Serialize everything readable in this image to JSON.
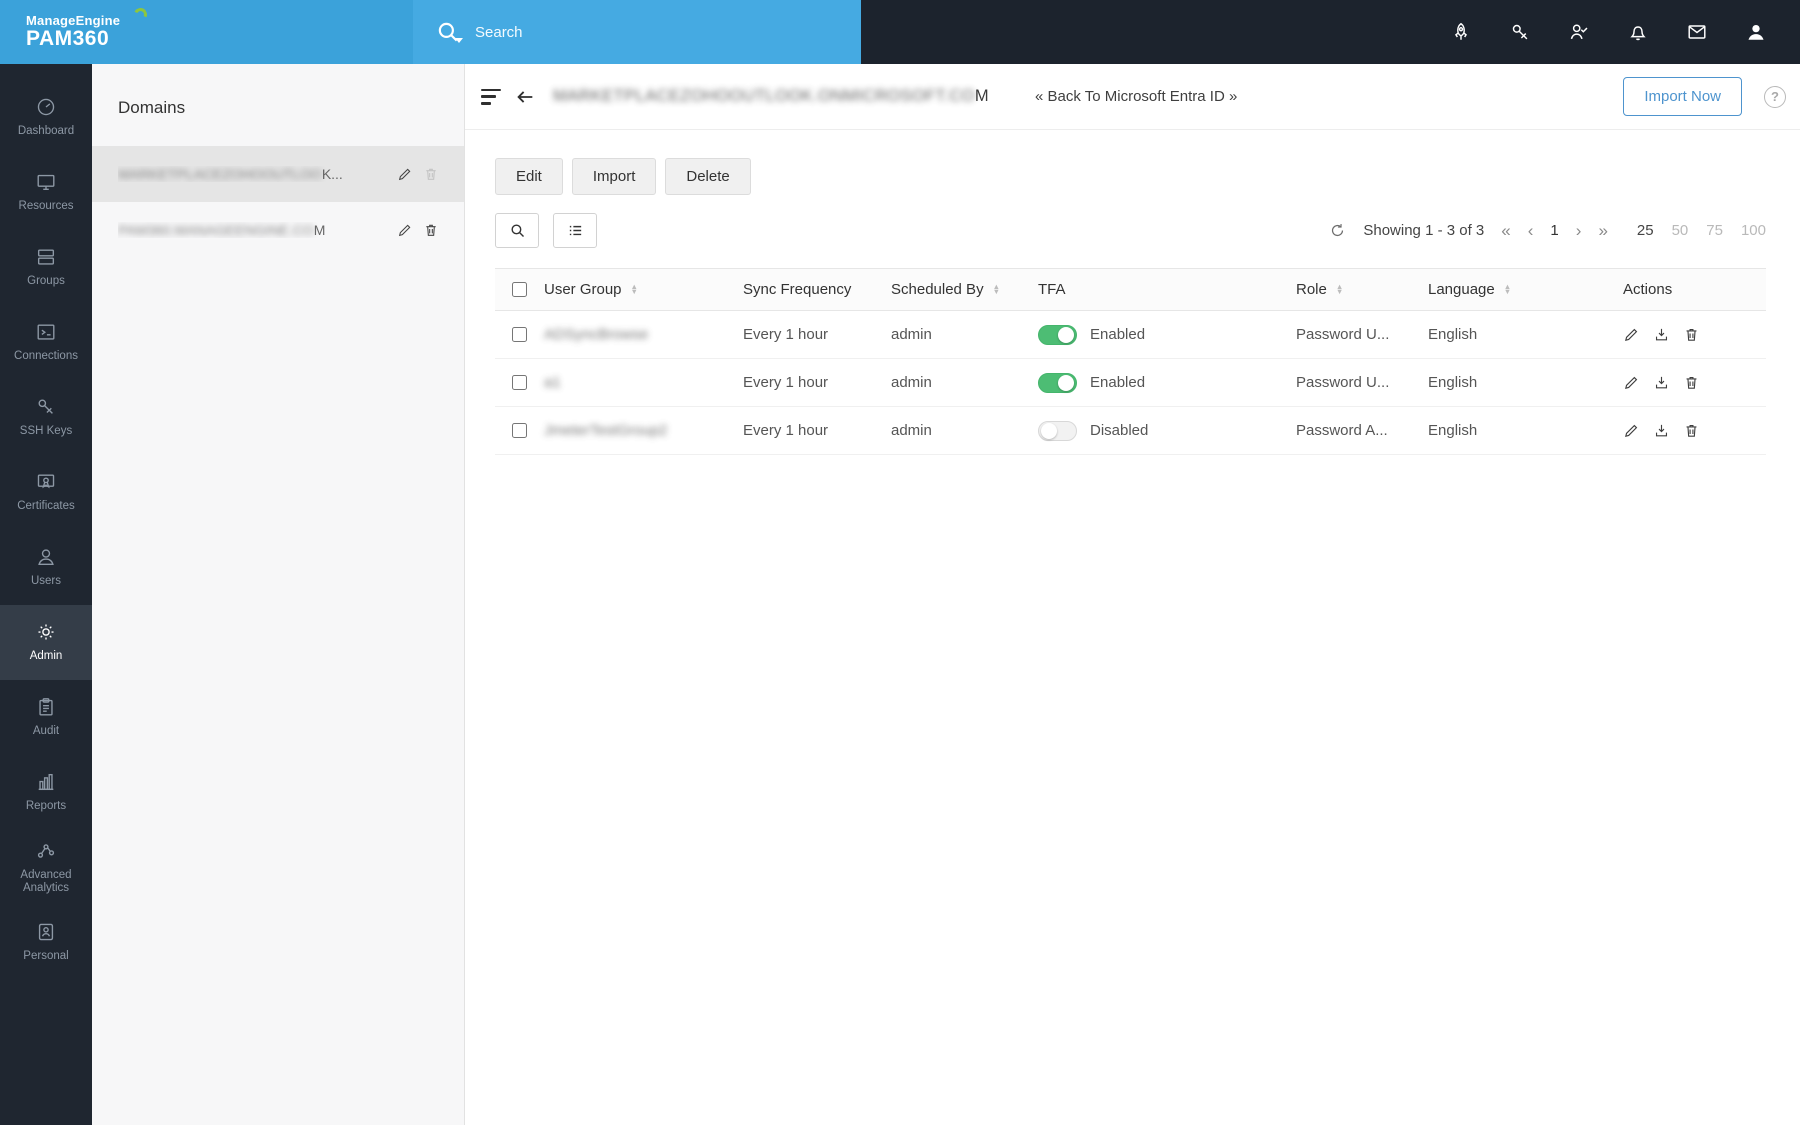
{
  "brand": {
    "company": "ManageEngine",
    "product": "PAM360"
  },
  "topbar": {
    "search_placeholder": "Search"
  },
  "sidebar": {
    "active_item": "Admin",
    "items": [
      {
        "label": "Dashboard"
      },
      {
        "label": "Resources"
      },
      {
        "label": "Groups"
      },
      {
        "label": "Connections"
      },
      {
        "label": "SSH Keys"
      },
      {
        "label": "Certificates"
      },
      {
        "label": "Users"
      },
      {
        "label": "Admin"
      },
      {
        "label": "Audit"
      },
      {
        "label": "Reports"
      },
      {
        "label": "Advanced Analytics"
      },
      {
        "label": "Personal"
      }
    ]
  },
  "domains_panel": {
    "title": "Domains",
    "items": [
      {
        "name": "MARKETPLACEZOHOOUTLOO",
        "suffix": "K...",
        "blurred": true,
        "selected": true,
        "delete_disabled": true
      },
      {
        "name": "PAM360.MANAGEENGINE.CO",
        "suffix": "M",
        "blurred": true,
        "selected": false,
        "delete_disabled": false
      }
    ]
  },
  "main": {
    "title_blurred": "MARKETPLACEZOHOOUTLOOK.ONMICROSOFT.CO",
    "title_suffix": "M",
    "title_is_blurred": true,
    "back_link": "« Back To Microsoft Entra ID »",
    "import_now_label": "Import Now",
    "help_label": "?",
    "toolbar": {
      "edit_label": "Edit",
      "import_label": "Import",
      "delete_label": "Delete"
    },
    "pagination": {
      "showing_text": "Showing 1 - 3 of 3",
      "first": "«",
      "prev": "‹",
      "next": "›",
      "last": "»",
      "current_page": "1",
      "page_sizes": [
        "25",
        "50",
        "75",
        "100"
      ],
      "active_page_size": "25"
    },
    "table": {
      "headers": {
        "user_group": "User Group",
        "sync_frequency": "Sync Frequency",
        "scheduled_by": "Scheduled By",
        "tfa": "TFA",
        "role": "Role",
        "language": "Language",
        "actions": "Actions"
      },
      "rows": [
        {
          "user_group": "ADSyncBrowse",
          "user_group_blurred": true,
          "sync_frequency": "Every 1 hour",
          "scheduled_by": "admin",
          "tfa_label": "Enabled",
          "tfa_on": "true",
          "role": "Password U...",
          "language": "English"
        },
        {
          "user_group": "a1",
          "user_group_blurred": true,
          "sync_frequency": "Every 1 hour",
          "scheduled_by": "admin",
          "tfa_label": "Enabled",
          "tfa_on": "true",
          "role": "Password U...",
          "language": "English"
        },
        {
          "user_group": "JmeterTestGroup2",
          "user_group_blurred": true,
          "sync_frequency": "Every 1 hour",
          "scheduled_by": "admin",
          "tfa_label": "Disabled",
          "tfa_on": "false",
          "role": "Password A...",
          "language": "English"
        }
      ]
    }
  },
  "colors": {
    "accent_blue": "#3ba2da",
    "toggle_green": "#4dbd74",
    "dark_chrome": "#1c232d",
    "import_now_blue": "#4e94ce"
  }
}
